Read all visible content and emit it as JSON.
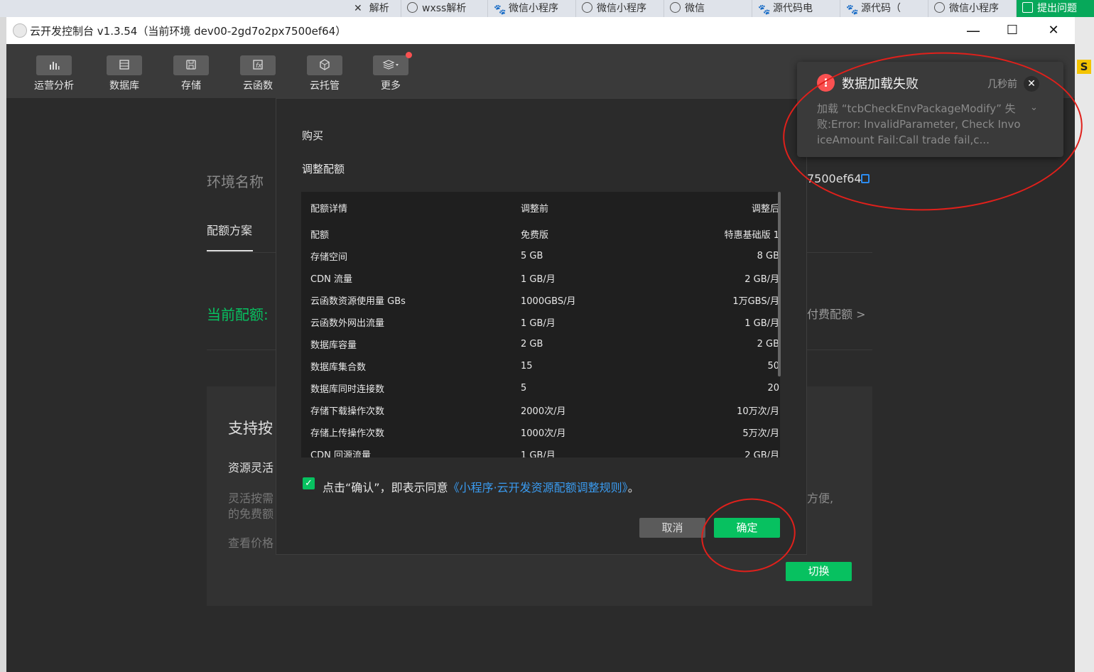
{
  "browser_tabs": [
    {
      "label": "解析",
      "icon": "close-icon"
    },
    {
      "label": "wxss解析",
      "icon": "globe-icon"
    },
    {
      "label": "微信小程序",
      "icon": "paw-icon"
    },
    {
      "label": "微信小程序",
      "icon": "globe-icon"
    },
    {
      "label": "微信",
      "icon": "globe-icon"
    },
    {
      "label": "源代码电",
      "icon": "paw-icon"
    },
    {
      "label": "源代码（",
      "icon": "paw-icon"
    },
    {
      "label": "微信小程序",
      "icon": "globe-icon"
    },
    {
      "label": "提出问题",
      "icon": "app-icon"
    }
  ],
  "window": {
    "title": "云开发控制台 v1.3.54（当前环境 dev00-2gd7o2px7500ef64）",
    "minimize": "—",
    "maximize": "☐",
    "close": "✕"
  },
  "toolbar": [
    {
      "label": "运营分析",
      "icon": "chart-bars-icon"
    },
    {
      "label": "数据库",
      "icon": "database-icon"
    },
    {
      "label": "存储",
      "icon": "save-icon"
    },
    {
      "label": "云函数",
      "icon": "function-icon"
    },
    {
      "label": "云托管",
      "icon": "cube-icon"
    },
    {
      "label": "更多",
      "icon": "layers-icon"
    }
  ],
  "background_page": {
    "env_label": "环境名称",
    "env_id_suffix": "7500ef64",
    "plan_tab": "配额方案",
    "current_quota": "当前配额:",
    "paid_quota": "付费配额",
    "support_title": "支持按",
    "resource": "资源灵活",
    "flex_line1": "灵活按需",
    "flex_line2": "的免费额",
    "view_price": "查看价格",
    "right_text": "方便,",
    "switch_button": "切换"
  },
  "modal": {
    "buy_label": "购买",
    "adjust_label": "调整配额",
    "table_headers": [
      "配额详情",
      "调整前",
      "调整后"
    ],
    "rows": [
      [
        "配额",
        "免费版",
        "特惠基础版 1"
      ],
      [
        "存储空间",
        "5 GB",
        "8 GB"
      ],
      [
        "CDN 流量",
        "1 GB/月",
        "2 GB/月"
      ],
      [
        "云函数资源使用量 GBs",
        "1000GBS/月",
        "1万GBS/月"
      ],
      [
        "云函数外网出流量",
        "1 GB/月",
        "1 GB/月"
      ],
      [
        "数据库容量",
        "2 GB",
        "2 GB"
      ],
      [
        "数据库集合数",
        "15",
        "50"
      ],
      [
        "数据库同时连接数",
        "5",
        "20"
      ],
      [
        "存储下载操作次数",
        "2000次/月",
        "10万次/月"
      ],
      [
        "存储上传操作次数",
        "1000次/月",
        "5万次/月"
      ],
      [
        "CDN 回源流量",
        "1 GB/月",
        "2 GB/月"
      ]
    ],
    "agree_prefix": "点击“确认”，即表示同意",
    "agree_link": "《小程序·云开发资源配额调整规则》",
    "agree_suffix": "。",
    "agree_checked": true,
    "cancel_button": "取消",
    "ok_button": "确定"
  },
  "notification": {
    "title": "数据加载失败",
    "time": "几秒前",
    "body": "加载 “tcbCheckEnvPackageModify” 失败:Error: InvalidParameter, Check InvoiceAmount Fail:Call trade fail,c..."
  },
  "colors": {
    "accent_green": "#07c160",
    "error_red": "#fa5151",
    "link_blue": "#3a9bf0",
    "annotation_red": "#e0201b"
  }
}
